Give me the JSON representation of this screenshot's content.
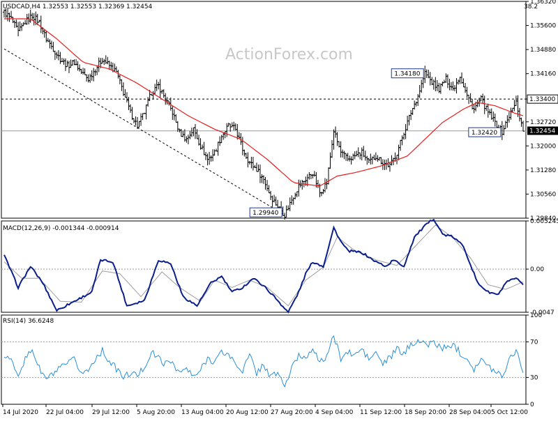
{
  "chart_data": [
    {
      "type": "ohlc",
      "title": "USDCAD,H4  1.32553 1.32553 1.32369 1.32454",
      "corner_value": "38.2",
      "watermark": "ActionForex.com",
      "ylim": [
        1.2984,
        1.3632
      ],
      "y_ticks": [
        "1.36320",
        "1.35600",
        "1.34880",
        "1.34160",
        "1.33400",
        "1.32720",
        "1.32000",
        "1.31280",
        "1.30560",
        "1.29840"
      ],
      "x_labels": [
        "14 Jul 2020",
        "22 Jul 04:00",
        "29 Jul 12:00",
        "5 Aug 20:00",
        "13 Aug 04:00",
        "20 Aug 12:00",
        "27 Aug 20:00",
        "4 Sep 04:00",
        "11 Sep 12:00",
        "18 Sep 20:00",
        "28 Sep 04:00",
        "5 Oct 12:00"
      ],
      "price_path": [
        [
          0,
          1.36
        ],
        [
          4,
          1.358
        ],
        [
          8,
          1.354
        ],
        [
          12,
          1.357
        ],
        [
          16,
          1.359
        ],
        [
          20,
          1.357
        ],
        [
          24,
          1.352
        ],
        [
          28,
          1.349
        ],
        [
          32,
          1.346
        ],
        [
          36,
          1.344
        ],
        [
          40,
          1.345
        ],
        [
          44,
          1.342
        ],
        [
          48,
          1.34
        ],
        [
          52,
          1.343
        ],
        [
          56,
          1.346
        ],
        [
          60,
          1.344
        ],
        [
          64,
          1.342
        ],
        [
          68,
          1.336
        ],
        [
          72,
          1.33
        ],
        [
          76,
          1.326
        ],
        [
          80,
          1.33
        ],
        [
          84,
          1.336
        ],
        [
          88,
          1.338
        ],
        [
          92,
          1.334
        ],
        [
          96,
          1.33
        ],
        [
          100,
          1.324
        ],
        [
          104,
          1.322
        ],
        [
          108,
          1.325
        ],
        [
          112,
          1.32
        ],
        [
          116,
          1.316
        ],
        [
          120,
          1.318
        ],
        [
          124,
          1.323
        ],
        [
          128,
          1.326
        ],
        [
          132,
          1.325
        ],
        [
          136,
          1.319
        ],
        [
          140,
          1.315
        ],
        [
          144,
          1.313
        ],
        [
          148,
          1.31
        ],
        [
          152,
          1.305
        ],
        [
          156,
          1.302
        ],
        [
          160,
          1.2994
        ],
        [
          164,
          1.304
        ],
        [
          168,
          1.308
        ],
        [
          172,
          1.31
        ],
        [
          176,
          1.312
        ],
        [
          180,
          1.306
        ],
        [
          184,
          1.309
        ],
        [
          188,
          1.3245
        ],
        [
          192,
          1.318
        ],
        [
          196,
          1.316
        ],
        [
          200,
          1.317
        ],
        [
          204,
          1.318
        ],
        [
          208,
          1.315
        ],
        [
          212,
          1.317
        ],
        [
          216,
          1.315
        ],
        [
          220,
          1.314
        ],
        [
          224,
          1.318
        ],
        [
          228,
          1.324
        ],
        [
          232,
          1.33
        ],
        [
          236,
          1.335
        ],
        [
          240,
          1.3418
        ],
        [
          244,
          1.339
        ],
        [
          248,
          1.337
        ],
        [
          252,
          1.34
        ],
        [
          256,
          1.337
        ],
        [
          260,
          1.341
        ],
        [
          264,
          1.335
        ],
        [
          268,
          1.331
        ],
        [
          272,
          1.334
        ],
        [
          276,
          1.33
        ],
        [
          280,
          1.327
        ],
        [
          284,
          1.3242
        ],
        [
          288,
          1.329
        ],
        [
          292,
          1.333
        ],
        [
          296,
          1.3245
        ]
      ],
      "ma_path": [
        [
          0,
          1.358
        ],
        [
          15,
          1.358
        ],
        [
          30,
          1.352
        ],
        [
          45,
          1.345
        ],
        [
          60,
          1.343
        ],
        [
          75,
          1.339
        ],
        [
          90,
          1.334
        ],
        [
          105,
          1.329
        ],
        [
          120,
          1.325
        ],
        [
          135,
          1.322
        ],
        [
          150,
          1.316
        ],
        [
          165,
          1.309
        ],
        [
          180,
          1.308
        ],
        [
          190,
          1.311
        ],
        [
          200,
          1.312
        ],
        [
          215,
          1.314
        ],
        [
          230,
          1.317
        ],
        [
          240,
          1.322
        ],
        [
          250,
          1.327
        ],
        [
          262,
          1.331
        ],
        [
          270,
          1.333
        ],
        [
          280,
          1.332
        ],
        [
          290,
          1.33
        ],
        [
          296,
          1.329
        ]
      ],
      "hline": 1.334,
      "support_line_value": 1.3245,
      "trendline": [
        [
          0,
          1.349
        ],
        [
          160,
          1.2994
        ]
      ],
      "annotations": [
        {
          "text": "1.34180",
          "x": 240,
          "y": 1.3418
        },
        {
          "text": "1.32420",
          "x": 284,
          "y": 1.3242
        },
        {
          "text": "1.29940",
          "x": 160,
          "y": 1.2994
        }
      ],
      "price_tags": [
        {
          "text": "1.33400",
          "y": 1.334,
          "style": "outline"
        },
        {
          "text": "1.32454",
          "y": 1.32454,
          "style": "filled"
        }
      ]
    },
    {
      "type": "line",
      "title": "MACD(12,26,9) -0.001344 -0.000914",
      "ylim": [
        -0.0047,
        0.005245
      ],
      "y_ticks": [
        "0.005245",
        "0.00",
        "-0.0047"
      ],
      "zero_line": 0,
      "macd_path": [
        [
          0,
          0.0015
        ],
        [
          8,
          -0.002
        ],
        [
          15,
          0.0003
        ],
        [
          22,
          -0.0015
        ],
        [
          30,
          -0.0045
        ],
        [
          40,
          -0.0035
        ],
        [
          50,
          -0.0025
        ],
        [
          55,
          0.001
        ],
        [
          62,
          0.0008
        ],
        [
          70,
          -0.004
        ],
        [
          80,
          -0.0034
        ],
        [
          88,
          0.001
        ],
        [
          95,
          0.0006
        ],
        [
          102,
          -0.003
        ],
        [
          110,
          -0.004
        ],
        [
          118,
          -0.0015
        ],
        [
          124,
          -0.0008
        ],
        [
          130,
          -0.0025
        ],
        [
          136,
          -0.002
        ],
        [
          142,
          -0.001
        ],
        [
          148,
          -0.0018
        ],
        [
          155,
          -0.0032
        ],
        [
          162,
          -0.0047
        ],
        [
          168,
          -0.0025
        ],
        [
          172,
          -0.0005
        ],
        [
          176,
          0.0008
        ],
        [
          182,
          0.0003
        ],
        [
          188,
          0.0045
        ],
        [
          192,
          0.003
        ],
        [
          196,
          0.002
        ],
        [
          204,
          0.0018
        ],
        [
          212,
          0.0008
        ],
        [
          218,
          0.0003
        ],
        [
          222,
          0.001
        ],
        [
          228,
          0.0003
        ],
        [
          234,
          0.0035
        ],
        [
          240,
          0.0047
        ],
        [
          245,
          0.0055
        ],
        [
          250,
          0.0038
        ],
        [
          256,
          0.0035
        ],
        [
          262,
          0.0025
        ],
        [
          266,
          0.0005
        ],
        [
          270,
          -0.0015
        ],
        [
          276,
          -0.0025
        ],
        [
          282,
          -0.0028
        ],
        [
          286,
          -0.0015
        ],
        [
          292,
          -0.001
        ],
        [
          296,
          -0.0018
        ]
      ],
      "signal_path": [
        [
          0,
          0.0008
        ],
        [
          10,
          -0.001
        ],
        [
          20,
          -0.001
        ],
        [
          32,
          -0.0035
        ],
        [
          44,
          -0.0036
        ],
        [
          56,
          -0.0002
        ],
        [
          66,
          -0.0005
        ],
        [
          78,
          -0.003
        ],
        [
          90,
          -0.0003
        ],
        [
          100,
          -0.002
        ],
        [
          112,
          -0.0035
        ],
        [
          120,
          -0.0012
        ],
        [
          130,
          -0.002
        ],
        [
          140,
          -0.0012
        ],
        [
          150,
          -0.002
        ],
        [
          162,
          -0.004
        ],
        [
          172,
          -0.0012
        ],
        [
          182,
          0.0002
        ],
        [
          190,
          0.0035
        ],
        [
          200,
          0.002
        ],
        [
          212,
          0.001
        ],
        [
          224,
          0.0004
        ],
        [
          236,
          0.0028
        ],
        [
          246,
          0.0048
        ],
        [
          256,
          0.0034
        ],
        [
          266,
          0.0012
        ],
        [
          276,
          -0.0017
        ],
        [
          286,
          -0.0022
        ],
        [
          296,
          -0.0014
        ]
      ]
    },
    {
      "type": "line",
      "title": "RSI(14) 36.6248",
      "ylim": [
        0,
        100
      ],
      "y_ticks": [
        "100",
        "70",
        "30",
        "0"
      ],
      "levels": [
        70,
        30
      ],
      "rsi_path": [
        [
          0,
          55
        ],
        [
          4,
          48
        ],
        [
          8,
          35
        ],
        [
          12,
          50
        ],
        [
          16,
          62
        ],
        [
          20,
          40
        ],
        [
          24,
          28
        ],
        [
          28,
          34
        ],
        [
          32,
          40
        ],
        [
          36,
          45
        ],
        [
          40,
          50
        ],
        [
          44,
          35
        ],
        [
          48,
          38
        ],
        [
          52,
          52
        ],
        [
          56,
          60
        ],
        [
          60,
          48
        ],
        [
          64,
          40
        ],
        [
          68,
          30
        ],
        [
          72,
          35
        ],
        [
          76,
          32
        ],
        [
          80,
          42
        ],
        [
          84,
          58
        ],
        [
          88,
          52
        ],
        [
          92,
          45
        ],
        [
          96,
          48
        ],
        [
          100,
          35
        ],
        [
          104,
          40
        ],
        [
          108,
          30
        ],
        [
          112,
          38
        ],
        [
          116,
          52
        ],
        [
          120,
          48
        ],
        [
          124,
          58
        ],
        [
          128,
          56
        ],
        [
          132,
          45
        ],
        [
          136,
          38
        ],
        [
          140,
          55
        ],
        [
          144,
          35
        ],
        [
          148,
          45
        ],
        [
          152,
          30
        ],
        [
          156,
          36
        ],
        [
          160,
          20
        ],
        [
          164,
          40
        ],
        [
          168,
          55
        ],
        [
          172,
          52
        ],
        [
          176,
          65
        ],
        [
          180,
          45
        ],
        [
          184,
          55
        ],
        [
          188,
          76
        ],
        [
          192,
          52
        ],
        [
          196,
          58
        ],
        [
          200,
          55
        ],
        [
          204,
          62
        ],
        [
          208,
          50
        ],
        [
          212,
          58
        ],
        [
          216,
          45
        ],
        [
          220,
          52
        ],
        [
          224,
          62
        ],
        [
          228,
          56
        ],
        [
          232,
          68
        ],
        [
          236,
          72
        ],
        [
          240,
          66
        ],
        [
          244,
          70
        ],
        [
          248,
          65
        ],
        [
          252,
          62
        ],
        [
          256,
          68
        ],
        [
          260,
          58
        ],
        [
          264,
          52
        ],
        [
          268,
          40
        ],
        [
          272,
          50
        ],
        [
          276,
          42
        ],
        [
          280,
          38
        ],
        [
          284,
          32
        ],
        [
          288,
          50
        ],
        [
          292,
          62
        ],
        [
          296,
          36.6
        ]
      ]
    }
  ]
}
